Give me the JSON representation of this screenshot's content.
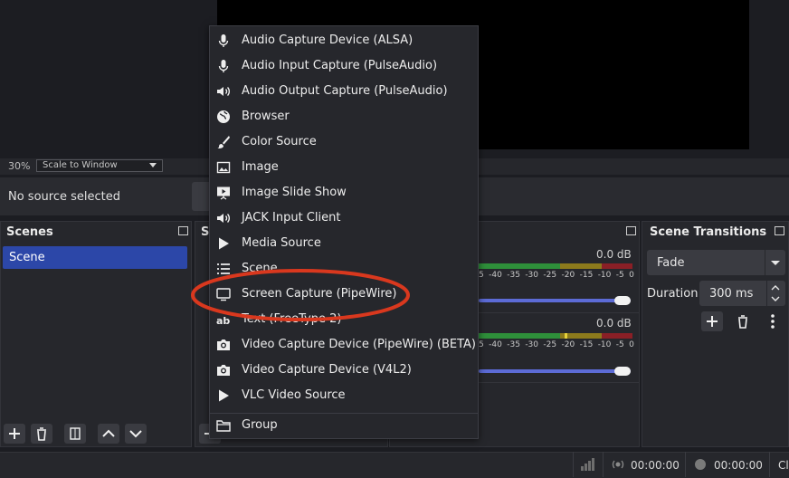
{
  "preview": {
    "zoom": "30%",
    "scale_mode": "Scale to Window"
  },
  "source_bar": {
    "status": "No source selected"
  },
  "scenes_dock": {
    "title": "Scenes",
    "items": [
      "Scene"
    ],
    "selected": "Scene"
  },
  "sources_dock": {
    "title_fragment": "S"
  },
  "mixer": {
    "tracks": [
      {
        "db": "0.0 dB",
        "ticks": [
          "5",
          "-40",
          "-35",
          "-30",
          "-25",
          "-20",
          "-15",
          "-10",
          "-5",
          "0"
        ],
        "volume_level": 1.0
      },
      {
        "db": "0.0 dB",
        "ticks": [
          "5",
          "-40",
          "-35",
          "-30",
          "-25",
          "-20",
          "-15",
          "-10",
          "-5",
          "0"
        ],
        "volume_level": 1.0
      }
    ]
  },
  "transitions_dock": {
    "title": "Scene Transitions",
    "selected_transition": "Fade",
    "duration_label": "Duration",
    "duration_value": "300 ms"
  },
  "status_bar": {
    "stream_time": "00:00:00",
    "record_time": "00:00:00",
    "cpu_fragment": "Cl"
  },
  "context_menu": {
    "items": [
      {
        "label": "Audio Capture Device (ALSA)",
        "icon": "microphone-icon"
      },
      {
        "label": "Audio Input Capture (PulseAudio)",
        "icon": "microphone-icon"
      },
      {
        "label": "Audio Output Capture (PulseAudio)",
        "icon": "speaker-icon"
      },
      {
        "label": "Browser",
        "icon": "globe-icon"
      },
      {
        "label": "Color Source",
        "icon": "paintbrush-icon"
      },
      {
        "label": "Image",
        "icon": "image-icon"
      },
      {
        "label": "Image Slide Show",
        "icon": "slideshow-icon"
      },
      {
        "label": "JACK Input Client",
        "icon": "speaker-icon"
      },
      {
        "label": "Media Source",
        "icon": "play-icon"
      },
      {
        "label": "Scene",
        "icon": "list-icon"
      },
      {
        "label": "Screen Capture (PipeWire)",
        "icon": "monitor-icon"
      },
      {
        "label": "Text (FreeType 2)",
        "icon": "text-icon"
      },
      {
        "label": "Video Capture Device (PipeWire) (BETA)",
        "icon": "camera-icon"
      },
      {
        "label": "Video Capture Device (V4L2)",
        "icon": "camera-icon"
      },
      {
        "label": "VLC Video Source",
        "icon": "play-icon"
      },
      {
        "label": "Group",
        "icon": "folder-icon"
      }
    ],
    "highlighted": "Screen Capture (PipeWire)",
    "highlight_color": "#d9381e"
  },
  "colors": {
    "accent": "#2c47a8",
    "volume_slider": "#5c6bd6",
    "meter_green": "#2e8f3a",
    "meter_yellow": "#8c7a1c",
    "meter_red": "#8a1f26"
  }
}
